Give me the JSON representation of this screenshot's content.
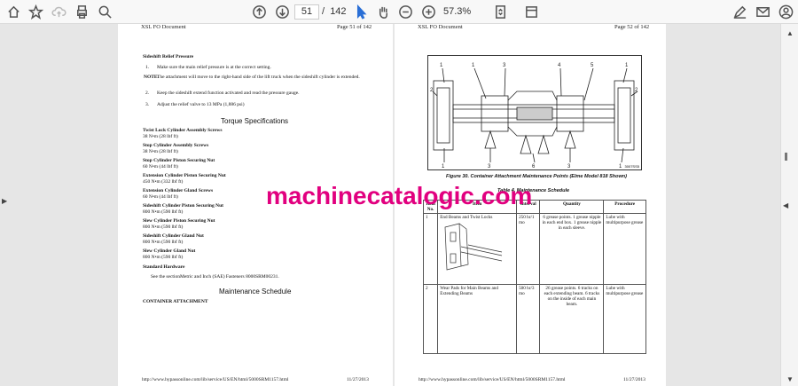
{
  "toolbar": {
    "page_current": "51",
    "page_sep": "/",
    "page_total": "142",
    "zoom": "57.3%"
  },
  "left_page": {
    "header_left": "XSL FO Document",
    "header_right": "Page 51 of 142",
    "section_title": "Sideshift Relief Pressure",
    "steps": [
      {
        "num": "1.",
        "text": "Make sure the main relief pressure is at the correct setting."
      },
      {
        "num": "NOTE:",
        "text": "The attachment will move to the right-hand side of the lift truck when the sideshift cylinder is extended."
      },
      {
        "num": "2.",
        "text": "Keep the sideshift extend function activated and read the pressure gauge."
      },
      {
        "num": "3.",
        "text": "Adjust the relief valve to 13  MPa (1,886 psi)"
      }
    ],
    "torque_title": "Torque Specifications",
    "torque_items": [
      {
        "name": "Twist Lock Cylinder Assembly Screws",
        "value": "38  N•m  (28 lbf  ft)"
      },
      {
        "name": "Stop Cylinder Assembly Screws",
        "value": "38  N•m  (28 lbf  ft)"
      },
      {
        "name": "Stop Cylinder Piston Securing Nut",
        "value": "60  N•m  (44 lbf  ft)"
      },
      {
        "name": "Extension Cylinder Piston Securing Nut",
        "value": "450  N•m  (332 lbf  ft)"
      },
      {
        "name": "Extension Cylinder Gland Screws",
        "value": "60  N•m  (44 lbf  ft)"
      },
      {
        "name": "Sideshift Cylinder Piston Securing Nut",
        "value": "800  N•m  (590 lbf  ft)"
      },
      {
        "name": "Slew Cylinder Piston Securing Nut",
        "value": "800  N•m  (590 lbf  ft)"
      },
      {
        "name": "Sideshift Cylinder Gland Nut",
        "value": "800  N•m  (590 lbf  ft)"
      },
      {
        "name": "Slew Cylinder Gland Nut",
        "value": "800  N•m  (590 lbf  ft)"
      }
    ],
    "standard_hardware": "Standard Hardware",
    "see_text": "See the sectionMetric and Inch (SAE) Fasteners 8000SRM00231.",
    "maint_title": "Maintenance Schedule",
    "container_attachment": "CONTAINER ATTACHMENT",
    "footer_url": "http://www.hypassonline.com/lib/service/US/EN/html/5000SRM1157.html",
    "footer_date": "11/27/2013"
  },
  "right_page": {
    "header_left": "XSL FO Document",
    "header_right": "Page 52 of 142",
    "figure_caption": "Figure 30. Container Attachment Maintenance Points (Elme Model 818 Shown)",
    "figure_code": "3007SS5",
    "table_title": "Table 4. Maintenance Schedule",
    "columns": [
      "Item No.",
      "Item",
      "Interval",
      "Quantity",
      "Procedure"
    ],
    "rows": [
      {
        "no": "1",
        "item": "End Beams and Twist Locks",
        "interval": "250 hr/1 mo",
        "quantity": "6 grease points. 1 grease nipple in each end box. 1 grease nipple in each sleeve.",
        "procedure": "Lube with multipurpose grease"
      },
      {
        "no": "2",
        "item": "Wear Pads for Main Beams and Extending Beams",
        "interval": "500 hr/3 mo",
        "quantity": "26 grease points. 6 tracks on each extending beam. 6 tracks on the inside of each main beam.",
        "procedure": "Lube with multipurpose grease"
      }
    ],
    "footer_url": "http://www.hypassonline.com/lib/service/US/EN/html/5000SRM1157.html",
    "footer_date": "11/27/2013"
  },
  "watermark": "machinecatalogic.com"
}
